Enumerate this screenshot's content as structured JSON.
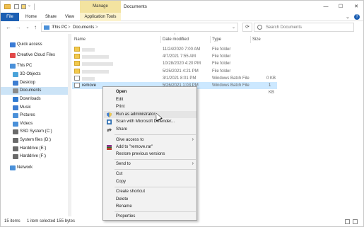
{
  "window": {
    "title": "Documents",
    "manage_tab": "Manage",
    "minimize": "—",
    "maximize": "☐",
    "close": "✕"
  },
  "ribbon": {
    "file": "File",
    "tabs": [
      "Home",
      "Share",
      "View"
    ],
    "tools_tab": "Application Tools",
    "collapse_icon": "⌄",
    "help_icon": "?"
  },
  "address": {
    "back": "←",
    "forward": "→",
    "recent": "⌄",
    "up": "↑",
    "crumb1": "This PC",
    "sep": ">",
    "crumb2": "Documents",
    "refresh": "⟳",
    "search_placeholder": "Search Documents"
  },
  "sidebar": {
    "items": [
      {
        "label": "Quick access",
        "color": "#3a7bd5"
      },
      {
        "label": "Creative Cloud Files",
        "color": "#e24a4a"
      },
      {
        "label": "This PC",
        "color": "#4a90d9"
      },
      {
        "label": "3D Objects",
        "color": "#4aa3d9"
      },
      {
        "label": "Desktop",
        "color": "#3d7dd1"
      },
      {
        "label": "Documents",
        "color": "#8a8a8a"
      },
      {
        "label": "Downloads",
        "color": "#2f7ad1"
      },
      {
        "label": "Music",
        "color": "#3d7dd1"
      },
      {
        "label": "Pictures",
        "color": "#4a90d9"
      },
      {
        "label": "Videos",
        "color": "#4a90d9"
      },
      {
        "label": "SSD System (C:)",
        "color": "#6a6a6a"
      },
      {
        "label": "System files (D:)",
        "color": "#6a6a6a"
      },
      {
        "label": "Harddrive (E:)",
        "color": "#6a6a6a"
      },
      {
        "label": "Harddrive (F:)",
        "color": "#6a6a6a"
      },
      {
        "label": "Network",
        "color": "#4a90d9"
      }
    ]
  },
  "columns": {
    "name": "Name",
    "date": "Date modified",
    "type": "Type",
    "size": "Size"
  },
  "files": [
    {
      "name": "",
      "date": "11/24/2020 7:00 AM",
      "type": "File folder",
      "size": ""
    },
    {
      "name": "",
      "date": "4/7/2021 7:55 AM",
      "type": "File folder",
      "size": ""
    },
    {
      "name": "",
      "date": "10/28/2020 4:20 PM",
      "type": "File folder",
      "size": ""
    },
    {
      "name": "",
      "date": "5/25/2021 4:21 PM",
      "type": "File folder",
      "size": ""
    },
    {
      "name": "",
      "date": "3/1/2021 8:01 PM",
      "type": "Windows Batch File",
      "size": "0 KB"
    },
    {
      "name": "remove",
      "date": "5/26/2021 1:03 PM",
      "type": "Windows Batch File",
      "size": "1 KB"
    }
  ],
  "status": {
    "items": "15 items",
    "selected": "1 item selected 155 bytes"
  },
  "context_menu": {
    "open": "Open",
    "edit": "Edit",
    "print": "Print",
    "run_admin": "Run as administrator",
    "scan": "Scan with Microsoft Defender...",
    "share": "Share",
    "give_access": "Give access to",
    "add_rar": "Add to \"remove.rar\"",
    "restore": "Restore previous versions",
    "send_to": "Send to",
    "cut": "Cut",
    "copy": "Copy",
    "create_shortcut": "Create shortcut",
    "delete": "Delete",
    "rename": "Rename",
    "properties": "Properties",
    "submenu_arrow": "›"
  }
}
